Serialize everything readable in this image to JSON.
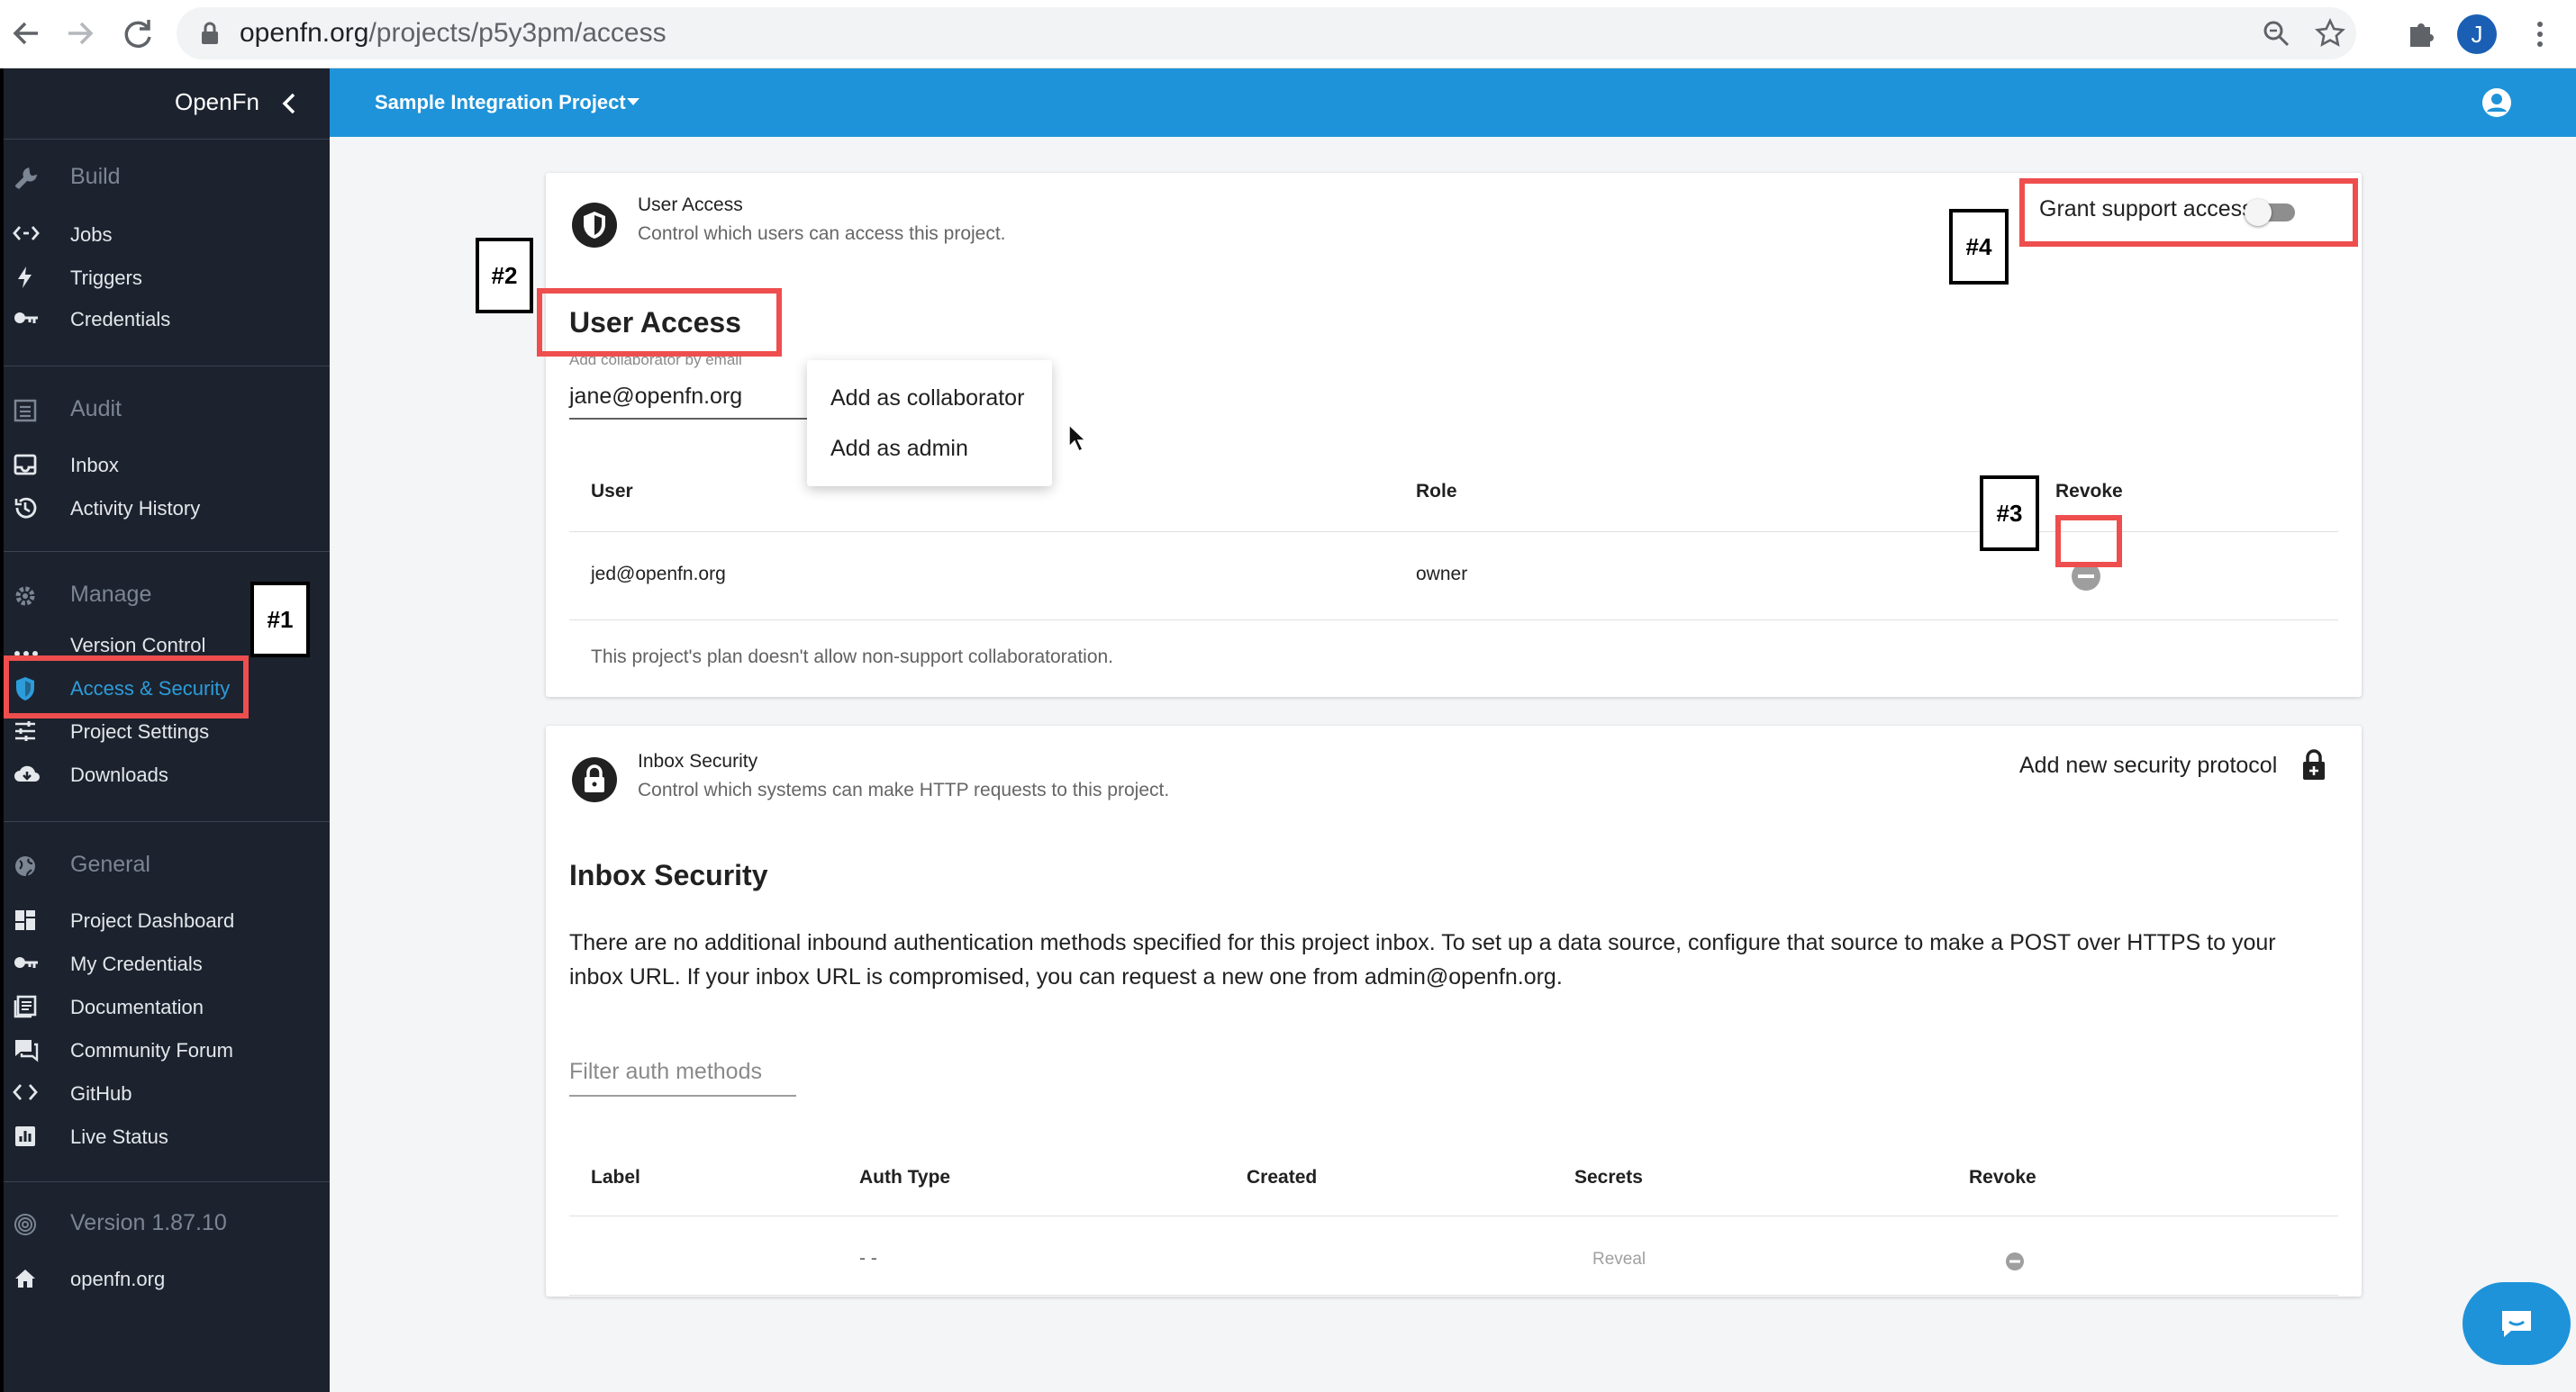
{
  "browser": {
    "url_host": "openfn.org",
    "url_path": "/projects/p5y3pm/access",
    "profile_initial": "J"
  },
  "sidebar": {
    "brand": "OpenFn",
    "sections": [
      {
        "title": "Build",
        "items": [
          "Jobs",
          "Triggers",
          "Credentials"
        ]
      },
      {
        "title": "Audit",
        "items": [
          "Inbox",
          "Activity History"
        ]
      },
      {
        "title": "Manage",
        "items": [
          "Version Control",
          "Access & Security",
          "Project Settings",
          "Downloads"
        ]
      },
      {
        "title": "General",
        "items": [
          "Project Dashboard",
          "My Credentials",
          "Documentation",
          "Community Forum",
          "GitHub",
          "Live Status"
        ]
      }
    ],
    "version": "Version 1.87.10",
    "home_link": "openfn.org"
  },
  "topbar": {
    "project_name": "Sample Integration Project"
  },
  "user_access": {
    "card_title": "User Access",
    "card_subtitle": "Control which users can access this project.",
    "grant_support_label": "Grant support access",
    "grant_support_enabled": false,
    "heading": "User Access",
    "input_label": "Add collaborator by email",
    "input_value": "jane@openfn.org",
    "menu": [
      "Add as collaborator",
      "Add as admin"
    ],
    "columns": [
      "User",
      "Role",
      "Revoke"
    ],
    "rows": [
      {
        "user": "jed@openfn.org",
        "role": "owner"
      }
    ],
    "plan_note": "This project's plan doesn't allow non-support collaboratoration."
  },
  "inbox_security": {
    "card_title": "Inbox Security",
    "card_subtitle": "Control which systems can make HTTP requests to this project.",
    "add_protocol_label": "Add new security protocol",
    "heading": "Inbox Security",
    "description_line1": "There are no additional inbound authentication methods specified for this project inbox. To set up a data source, configure that source to make a POST over HTTPS to your",
    "description_line2": "inbox URL. If your inbox URL is compromised, you can request a new one from admin@openfn.org.",
    "filter_placeholder": "Filter auth methods",
    "columns": [
      "Label",
      "Auth Type",
      "Created",
      "Secrets",
      "Revoke"
    ],
    "rows": [
      {
        "label": "",
        "auth_type": "- -",
        "created": "",
        "secrets": "Reveal"
      }
    ]
  },
  "annotations": [
    "#1",
    "#2",
    "#3",
    "#4"
  ],
  "colors": {
    "sidebar_bg": "#1c232e",
    "topbar_bg": "#1e93d9",
    "active_link": "#2d9cdb",
    "highlight_red": "#ee4e4e"
  }
}
